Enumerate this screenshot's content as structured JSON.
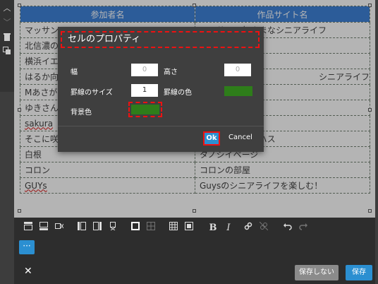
{
  "table": {
    "headers": [
      "参加者名",
      "作品サイト名"
    ],
    "rows": [
      [
        "マッサン",
        "マッサンの気ままなシニアライフ"
      ],
      [
        "北信濃の",
        ""
      ],
      [
        "横浜イエ",
        ""
      ],
      [
        "はるか向",
        "シニアライフ"
      ],
      [
        "Mあさが",
        ""
      ],
      [
        "ゆきさん",
        ""
      ],
      [
        "sakura",
        ""
      ],
      [
        "そこに咲いて花ハス",
        "そこに咲いて花ハス"
      ],
      [
        "白根",
        "タノシイページ"
      ],
      [
        "コロン",
        "コロンの部屋"
      ],
      [
        "GUYs",
        "Guysのシニアライフを楽しむ！"
      ]
    ]
  },
  "dialog": {
    "title": "セルのプロパティ",
    "width_label": "幅",
    "width_value": "0",
    "height_label": "高さ",
    "height_value": "0",
    "border_size_label": "罫線のサイズ",
    "border_size_value": "1",
    "border_color_label": "罫線の色",
    "bg_color_label": "背景色",
    "ok_label": "Ok",
    "cancel_label": "Cancel",
    "border_color": "#2e7d1a",
    "bg_color": "#2e7d1a"
  },
  "toolbar": {
    "more_label": "···",
    "bold_label": "B",
    "italic_label": "I"
  },
  "footer": {
    "close_label": "✕",
    "nosave_label": "保存しない",
    "save_label": "保存"
  },
  "colors": {
    "accent": "#2b8fd1",
    "header_bg": "#2f78d6",
    "highlight": "#e11111"
  }
}
